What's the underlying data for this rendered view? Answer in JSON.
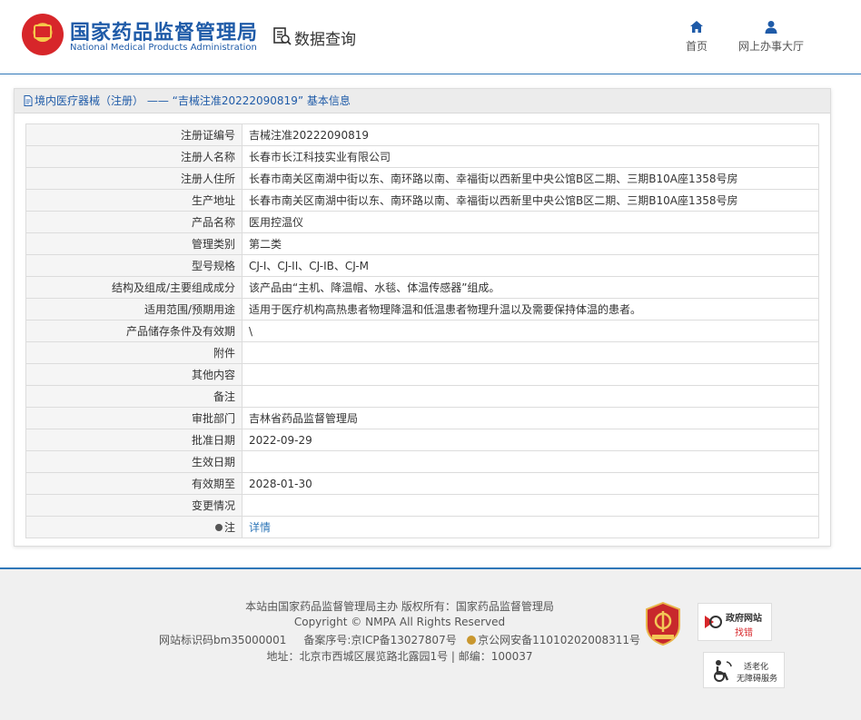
{
  "header": {
    "brand_cn": "国家药品监督管理局",
    "brand_en": "National Medical Products Administration",
    "data_query": "数据查询",
    "nav": [
      {
        "label": "首页",
        "icon": "home-icon"
      },
      {
        "label": "网上办事大厅",
        "icon": "user-icon"
      }
    ]
  },
  "panel": {
    "title": "境内医疗器械（注册） —— “吉械注准20222090819” 基本信息"
  },
  "rows": [
    {
      "label": "注册证编号",
      "value": "吉械注准20222090819"
    },
    {
      "label": "注册人名称",
      "value": "长春市长江科技实业有限公司"
    },
    {
      "label": "注册人住所",
      "value": "长春市南关区南湖中街以东、南环路以南、幸福街以西新里中央公馆B区二期、三期B10A座1358号房"
    },
    {
      "label": "生产地址",
      "value": "长春市南关区南湖中街以东、南环路以南、幸福街以西新里中央公馆B区二期、三期B10A座1358号房"
    },
    {
      "label": "产品名称",
      "value": "医用控温仪"
    },
    {
      "label": "管理类别",
      "value": "第二类"
    },
    {
      "label": "型号规格",
      "value": "CJ-I、CJ-II、CJ-IB、CJ-M"
    },
    {
      "label": "结构及组成/主要组成成分",
      "value": "该产品由“主机、降温帽、水毯、体温传感器”组成。"
    },
    {
      "label": "适用范围/预期用途",
      "value": "适用于医疗机构高热患者物理降温和低温患者物理升温以及需要保持体温的患者。"
    },
    {
      "label": "产品储存条件及有效期",
      "value": "\\"
    },
    {
      "label": "附件",
      "value": ""
    },
    {
      "label": "其他内容",
      "value": ""
    },
    {
      "label": "备注",
      "value": ""
    },
    {
      "label": "审批部门",
      "value": "吉林省药品监督管理局"
    },
    {
      "label": "批准日期",
      "value": "2022-09-29"
    },
    {
      "label": "生效日期",
      "value": ""
    },
    {
      "label": "有效期至",
      "value": "2028-01-30"
    },
    {
      "label": "变更情况",
      "value": ""
    },
    {
      "label": "注",
      "value": "详情"
    }
  ],
  "footer": {
    "line1": "本站由国家药品监督管理局主办 版权所有：国家药品监督管理局",
    "line2": "Copyright © NMPA All Rights Reserved",
    "site_id": "网站标识码bm35000001",
    "icp": "备案序号:京ICP备13027807号",
    "police": "京公网安备11010202008311号",
    "address": "地址：北京市西城区展览路北露园1号 | 邮编：100037",
    "badge_find_title": "政府网站",
    "badge_find_sub": "找错",
    "badge_acc_title": "适老化",
    "badge_acc_sub": "无障碍服务",
    "emblem_icon": "party-gov-emblem-icon"
  },
  "colors": {
    "brand_blue": "#1f5ba8",
    "link_blue": "#2f77b8",
    "emblem_red": "#d7262a"
  }
}
